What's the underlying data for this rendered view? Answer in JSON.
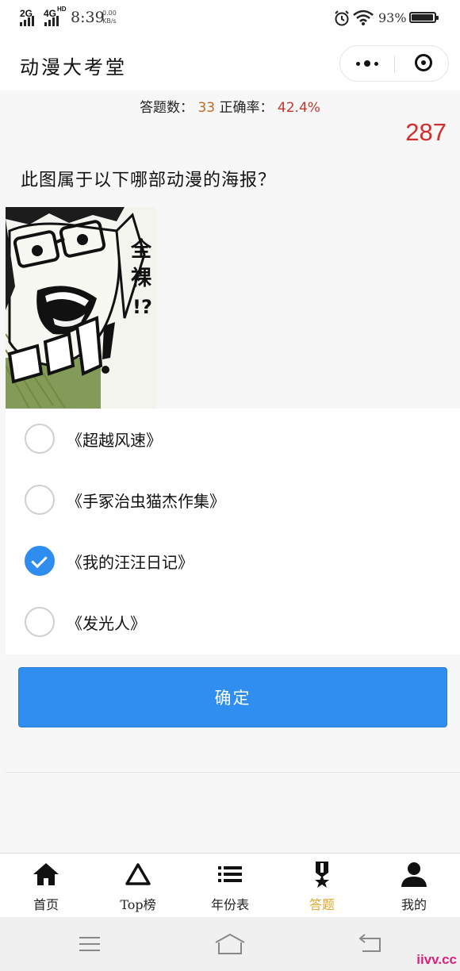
{
  "status_bar": {
    "net1": "2G",
    "net2": "4G",
    "net2_sup": "HD",
    "time": "8:39",
    "speed_value": "0.00",
    "speed_unit": "KB/s",
    "battery": "93%"
  },
  "nav": {
    "title": "动漫大考堂"
  },
  "stats": {
    "answered_label": "答题数：",
    "answered_value": "33",
    "accuracy_label": "正确率：",
    "accuracy_value": "42.4%"
  },
  "timer": "287",
  "question": "此图属于以下哪部动漫的海报？",
  "poster": {
    "text1": "全",
    "text2": "裸",
    "text3": "!?"
  },
  "options": [
    {
      "label": "《超越风速》",
      "selected": false
    },
    {
      "label": "《手冢治虫猫杰作集》",
      "selected": false
    },
    {
      "label": "《我的汪汪日记》",
      "selected": true
    },
    {
      "label": "《发光人》",
      "selected": false
    }
  ],
  "confirm_label": "确定",
  "tabs": [
    {
      "label": "首页",
      "icon": "home-icon"
    },
    {
      "label": "Top榜",
      "icon": "triangle-icon"
    },
    {
      "label": "年份表",
      "icon": "list-icon"
    },
    {
      "label": "答题",
      "icon": "medal-icon",
      "active": true
    },
    {
      "label": "我的",
      "icon": "user-icon"
    }
  ],
  "colors": {
    "accent": "#2f8ef0",
    "timer": "#d42b2b",
    "answered": "#c9681b",
    "accuracy": "#c0392b",
    "active_tab": "#e4a82a"
  },
  "watermark": "iivv.cc"
}
